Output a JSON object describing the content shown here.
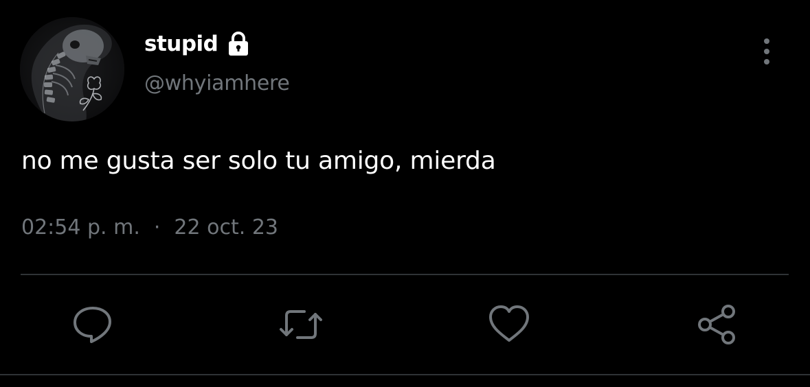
{
  "user": {
    "display_name": "stupid",
    "handle": "@whyiamhere",
    "protected_icon": "lock-icon",
    "avatar_icon": "skeleton-flower-avatar"
  },
  "tweet": {
    "text": "no me gusta ser solo tu amigo, mierda",
    "time": "02:54 p. m.",
    "separator": "·",
    "date": "22 oct. 23"
  },
  "actions": [
    {
      "name": "reply",
      "icon": "comment-icon"
    },
    {
      "name": "retweet",
      "icon": "retweet-icon"
    },
    {
      "name": "like",
      "icon": "heart-icon"
    },
    {
      "name": "share",
      "icon": "share-icon"
    }
  ],
  "colors": {
    "background": "#000000",
    "text_primary": "#ffffff",
    "text_secondary": "#71767b",
    "icon": "#71767b",
    "divider": "#2f3336"
  }
}
